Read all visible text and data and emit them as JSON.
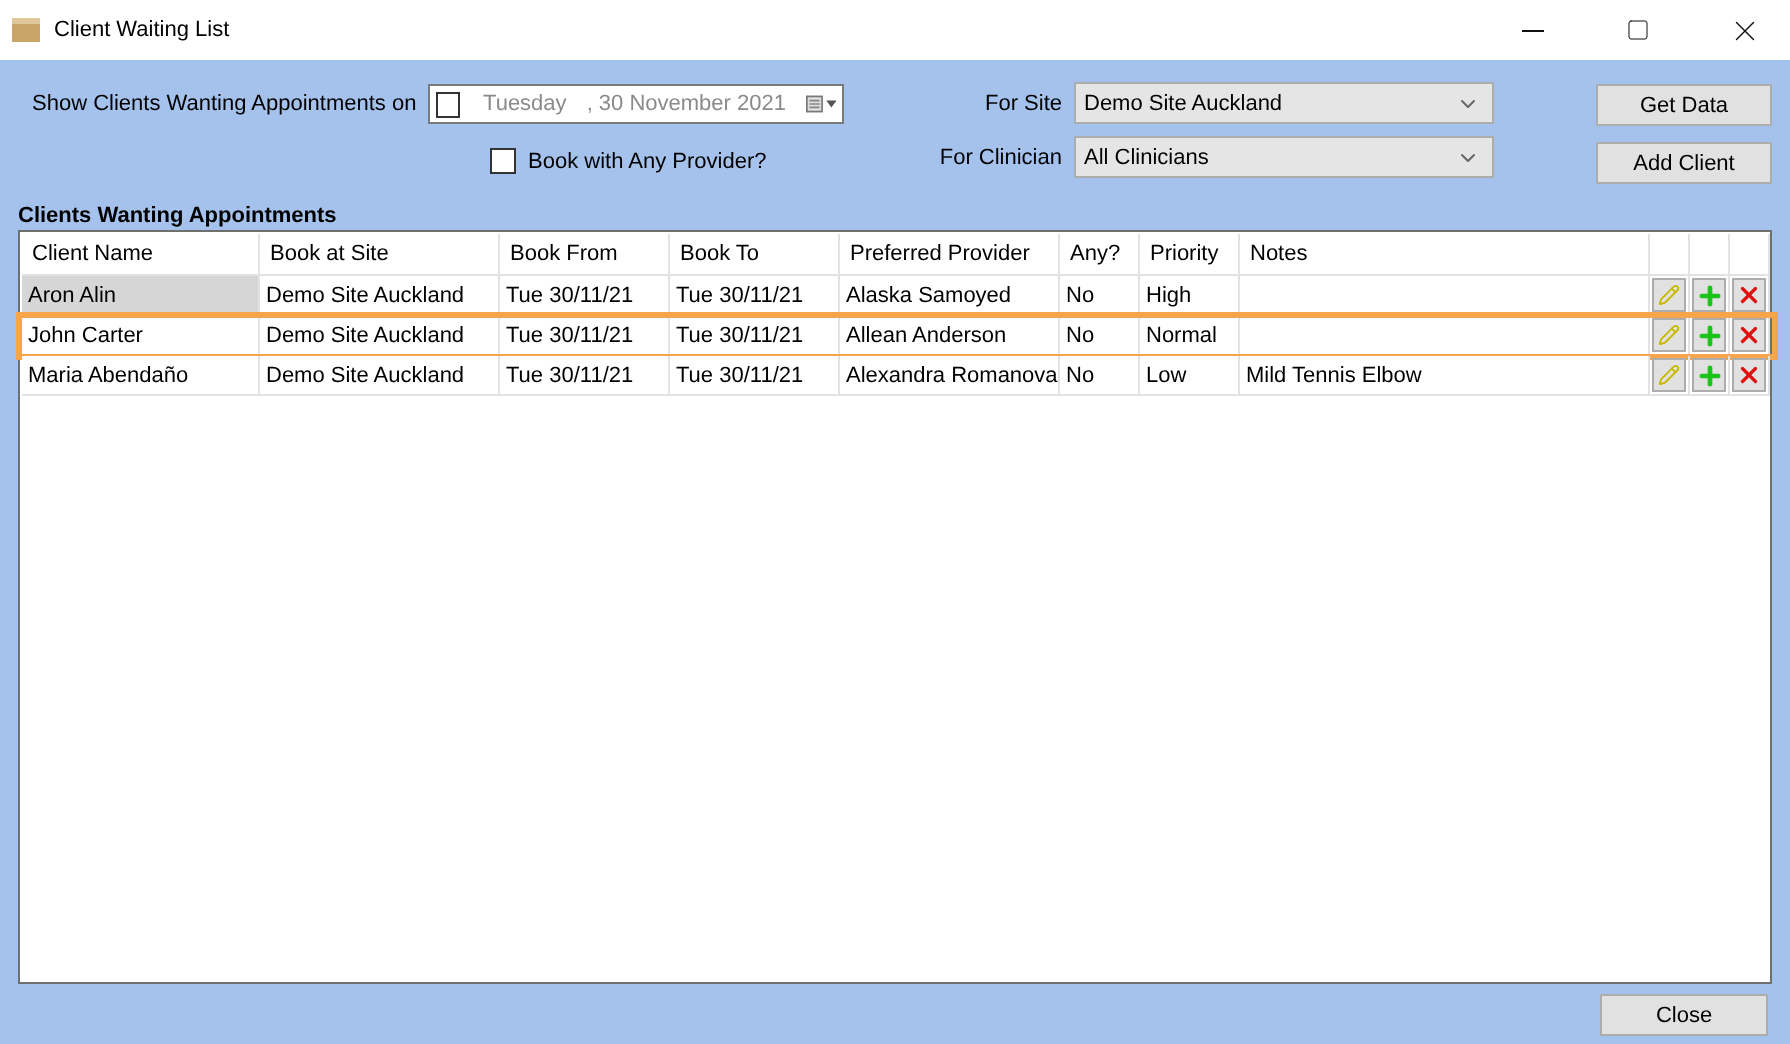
{
  "window": {
    "title": "Client Waiting List"
  },
  "filters": {
    "date_label": "Show Clients Wanting Appointments on",
    "date_checked": false,
    "date_day": "Tuesday",
    "date_rest": ", 30 November 2021",
    "any_provider": {
      "label": "Book with Any Provider?",
      "checked": false
    },
    "site_label": "For Site",
    "site_value": "Demo Site Auckland",
    "clinician_label": "For Clinician",
    "clinician_value": "All Clinicians"
  },
  "buttons": [
    "Get Data",
    "Add Client"
  ],
  "section_title": "Clients Wanting Appointments",
  "table": {
    "columns": [
      "Client Name",
      "Book at Site",
      "Book From",
      "Book To",
      "Preferred Provider",
      "Any?",
      "Priority",
      "Notes"
    ],
    "rows": [
      {
        "cells": [
          "Aron Alin",
          "Demo Site Auckland",
          "Tue 30/11/21",
          "Tue 30/11/21",
          "Alaska Samoyed",
          "No",
          "High",
          ""
        ],
        "selected": true,
        "highlighted": false
      },
      {
        "cells": [
          "John Carter",
          "Demo Site Auckland",
          "Tue 30/11/21",
          "Tue 30/11/21",
          "Allean Anderson",
          "No",
          "Normal",
          ""
        ],
        "selected": false,
        "highlighted": true
      },
      {
        "cells": [
          "Maria Abendaño",
          "Demo Site Auckland",
          "Tue 30/11/21",
          "Tue 30/11/21",
          "Alexandra Romanova",
          "No",
          "Low",
          "Mild Tennis Elbow"
        ],
        "selected": false,
        "highlighted": false
      }
    ]
  },
  "close_button": "Close"
}
